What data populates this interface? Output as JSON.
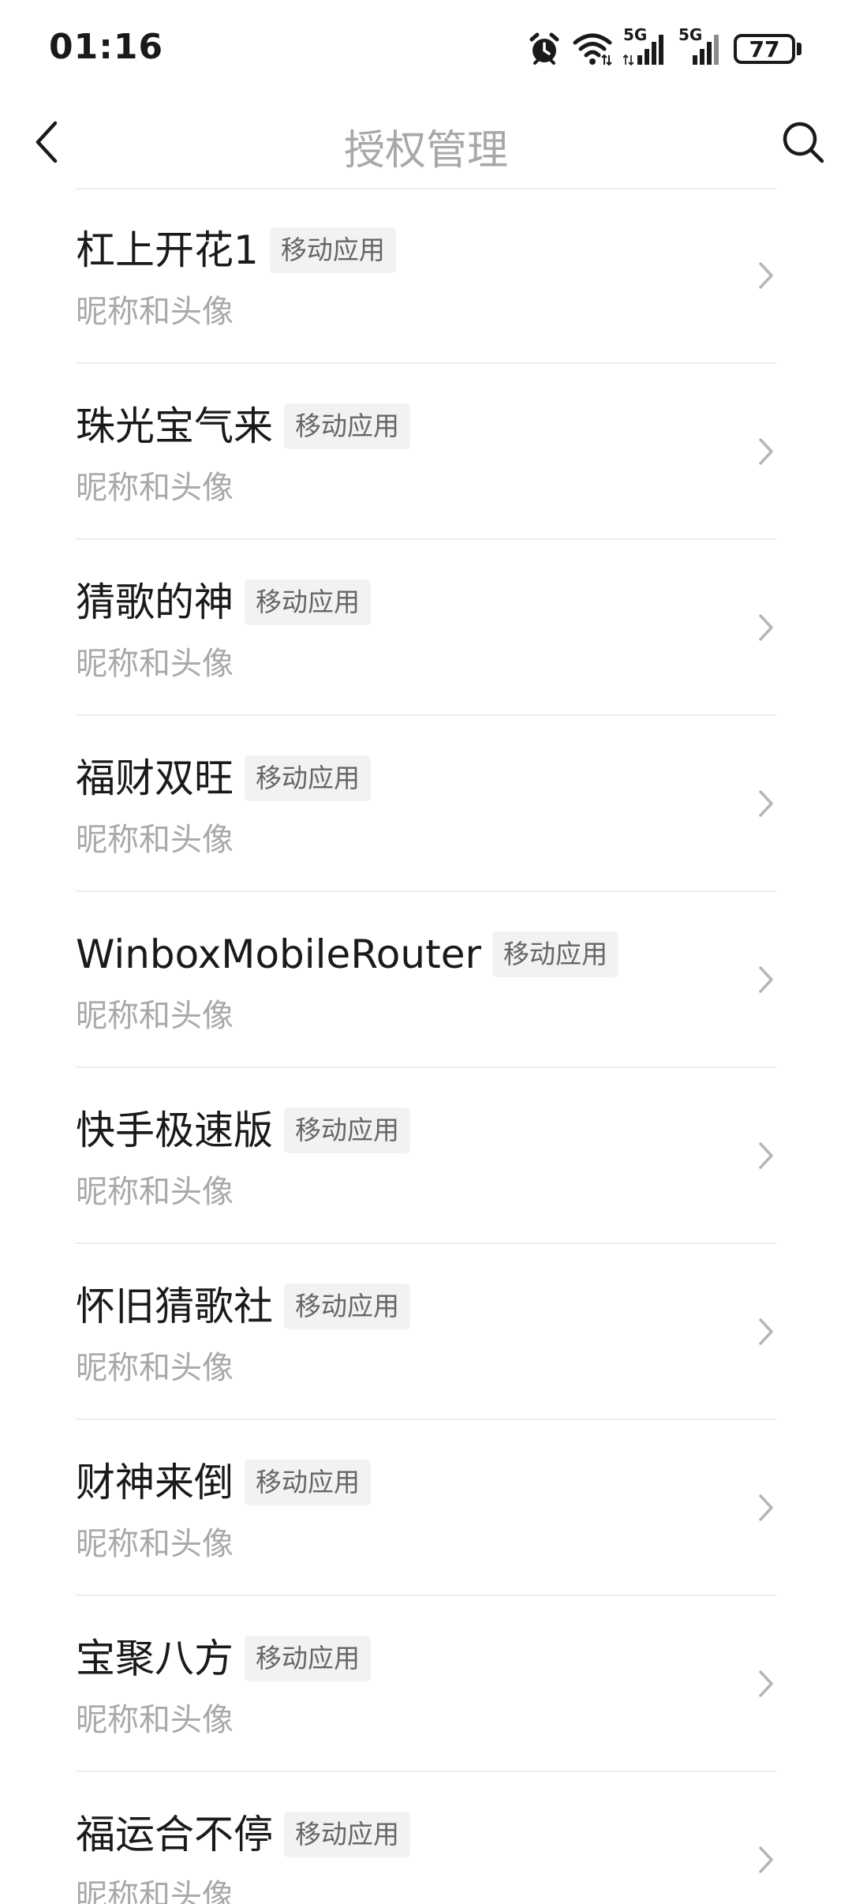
{
  "status_bar": {
    "time": "01:16",
    "battery": "77",
    "icons": [
      "alarm-icon",
      "wifi-icon",
      "signal-5g-icon",
      "signal-5g-icon",
      "battery-icon"
    ],
    "network_label_1": "5G",
    "network_label_2": "5G"
  },
  "header": {
    "title": "授权管理",
    "back_icon": "chevron-left-icon",
    "search_icon": "search-icon"
  },
  "list": {
    "items": [
      {
        "title": "杠上开花1",
        "badge": "移动应用",
        "subtitle": "昵称和头像"
      },
      {
        "title": "珠光宝气来",
        "badge": "移动应用",
        "subtitle": "昵称和头像"
      },
      {
        "title": "猜歌的神",
        "badge": "移动应用",
        "subtitle": "昵称和头像"
      },
      {
        "title": "福财双旺",
        "badge": "移动应用",
        "subtitle": "昵称和头像"
      },
      {
        "title": "WinboxMobileRouter",
        "badge": "移动应用",
        "subtitle": "昵称和头像"
      },
      {
        "title": "快手极速版",
        "badge": "移动应用",
        "subtitle": "昵称和头像"
      },
      {
        "title": "怀旧猜歌社",
        "badge": "移动应用",
        "subtitle": "昵称和头像"
      },
      {
        "title": "财神来倒",
        "badge": "移动应用",
        "subtitle": "昵称和头像"
      },
      {
        "title": "宝聚八方",
        "badge": "移动应用",
        "subtitle": "昵称和头像"
      },
      {
        "title": "福运合不停",
        "badge": "移动应用",
        "subtitle": "昵称和头像"
      }
    ]
  },
  "colors": {
    "text_primary": "#1a1a1a",
    "text_secondary": "#a9a9a9",
    "title_gray": "#a8a8a8",
    "badge_bg": "#f2f2f2",
    "badge_text": "#666666",
    "divider": "#ececec"
  }
}
